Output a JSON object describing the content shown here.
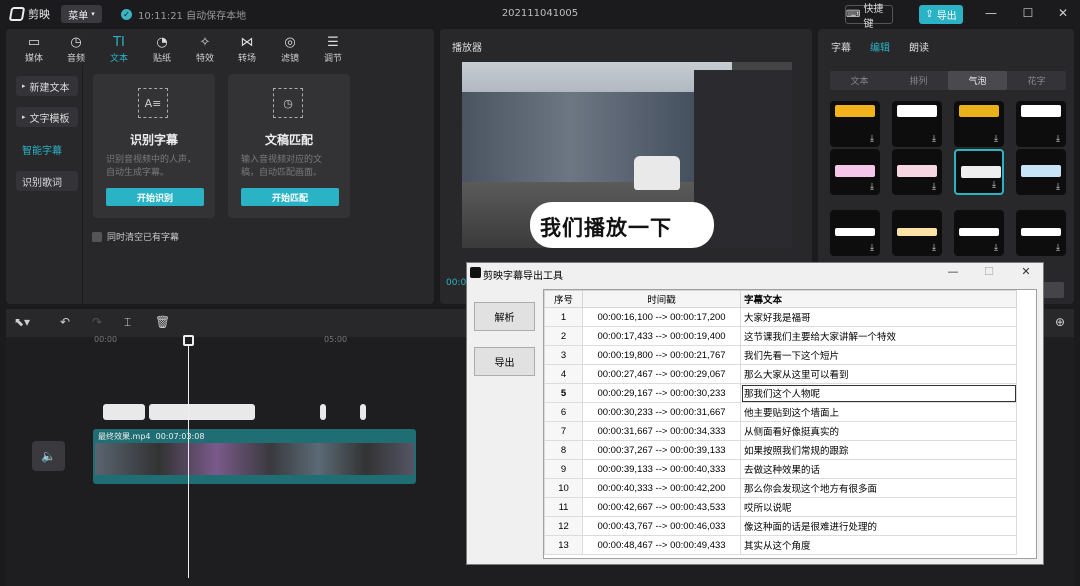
{
  "app": {
    "name": "剪映",
    "menu_label": "菜单",
    "save_status": "10:11:21 自动保存本地",
    "project_title": "202111041005",
    "shortcut_label": "快捷键",
    "export_label": "导出"
  },
  "toolbar": {
    "tools": [
      {
        "label": "媒体",
        "icon": "media-icon"
      },
      {
        "label": "音频",
        "icon": "audio-icon"
      },
      {
        "label": "文本",
        "icon": "text-icon"
      },
      {
        "label": "贴纸",
        "icon": "sticker-icon"
      },
      {
        "label": "特效",
        "icon": "effects-icon"
      },
      {
        "label": "转场",
        "icon": "transition-icon"
      },
      {
        "label": "滤镜",
        "icon": "filter-icon"
      },
      {
        "label": "调节",
        "icon": "adjust-icon"
      }
    ],
    "active": "文本"
  },
  "text_panel": {
    "subnav": [
      "新建文本",
      "文字模板",
      "智能字幕",
      "识别歌词"
    ],
    "active_subnav": "智能字幕",
    "cards": [
      {
        "title": "识别字幕",
        "desc": "识别音视频中的人声，自动生成字幕。",
        "button": "开始识别"
      },
      {
        "title": "文稿匹配",
        "desc": "输入音视频对应的文稿，自动匹配画面。",
        "button": "开始匹配"
      }
    ],
    "clear_option": "同时清空已有字幕"
  },
  "player": {
    "title": "播放器",
    "subtitle": "我们播放一下",
    "time_fragment": "00:0"
  },
  "right_panel": {
    "tabs": [
      "字幕",
      "编辑",
      "朗读"
    ],
    "active_tab": "编辑",
    "style_tabs": [
      "文本",
      "排列",
      "气泡",
      "花字"
    ],
    "active_style": "气泡"
  },
  "timeline": {
    "ruler": [
      "00:00",
      "05:00"
    ],
    "clip_name": "最终效果.mp4",
    "clip_duration": "00:07:03:08"
  },
  "tool_window": {
    "title": "剪映字幕导出工具",
    "buttons": {
      "parse": "解析",
      "export": "导出"
    },
    "columns": {
      "index": "序号",
      "time": "时间戳",
      "text": "字幕文本"
    },
    "selected_row": 5,
    "rows": [
      {
        "idx": "1",
        "time": "00:00:16,100 --> 00:00:17,200",
        "text": "大家好我是福哥"
      },
      {
        "idx": "2",
        "time": "00:00:17,433 --> 00:00:19,400",
        "text": "这节课我们主要给大家讲解一个特效"
      },
      {
        "idx": "3",
        "time": "00:00:19,800 --> 00:00:21,767",
        "text": "我们先看一下这个短片"
      },
      {
        "idx": "4",
        "time": "00:00:27,467 --> 00:00:29,067",
        "text": "那么大家从这里可以看到"
      },
      {
        "idx": "5",
        "time": "00:00:29,167 --> 00:00:30,233",
        "text": "那我们这个人物呢"
      },
      {
        "idx": "6",
        "time": "00:00:30,233 --> 00:00:31,667",
        "text": "他主要贴到这个墙面上"
      },
      {
        "idx": "7",
        "time": "00:00:31,667 --> 00:00:34,333",
        "text": "从侧面看好像挺真实的"
      },
      {
        "idx": "8",
        "time": "00:00:37,267 --> 00:00:39,133",
        "text": "如果按照我们常规的跟踪"
      },
      {
        "idx": "9",
        "time": "00:00:39,133 --> 00:00:40,333",
        "text": "去做这种效果的话"
      },
      {
        "idx": "10",
        "time": "00:00:40,333 --> 00:00:42,200",
        "text": "那么你会发现这个地方有很多面"
      },
      {
        "idx": "11",
        "time": "00:00:42,667 --> 00:00:43,533",
        "text": "哎所以说呢"
      },
      {
        "idx": "12",
        "time": "00:00:43,767 --> 00:00:46,033",
        "text": "像这种面的话是很难进行处理的"
      },
      {
        "idx": "13",
        "time": "00:00:48,467 --> 00:00:49,433",
        "text": "其实从这个角度"
      }
    ]
  },
  "colors": {
    "accent": "#2ab3c4",
    "panel": "#28282b",
    "background": "#1b1b1d"
  }
}
